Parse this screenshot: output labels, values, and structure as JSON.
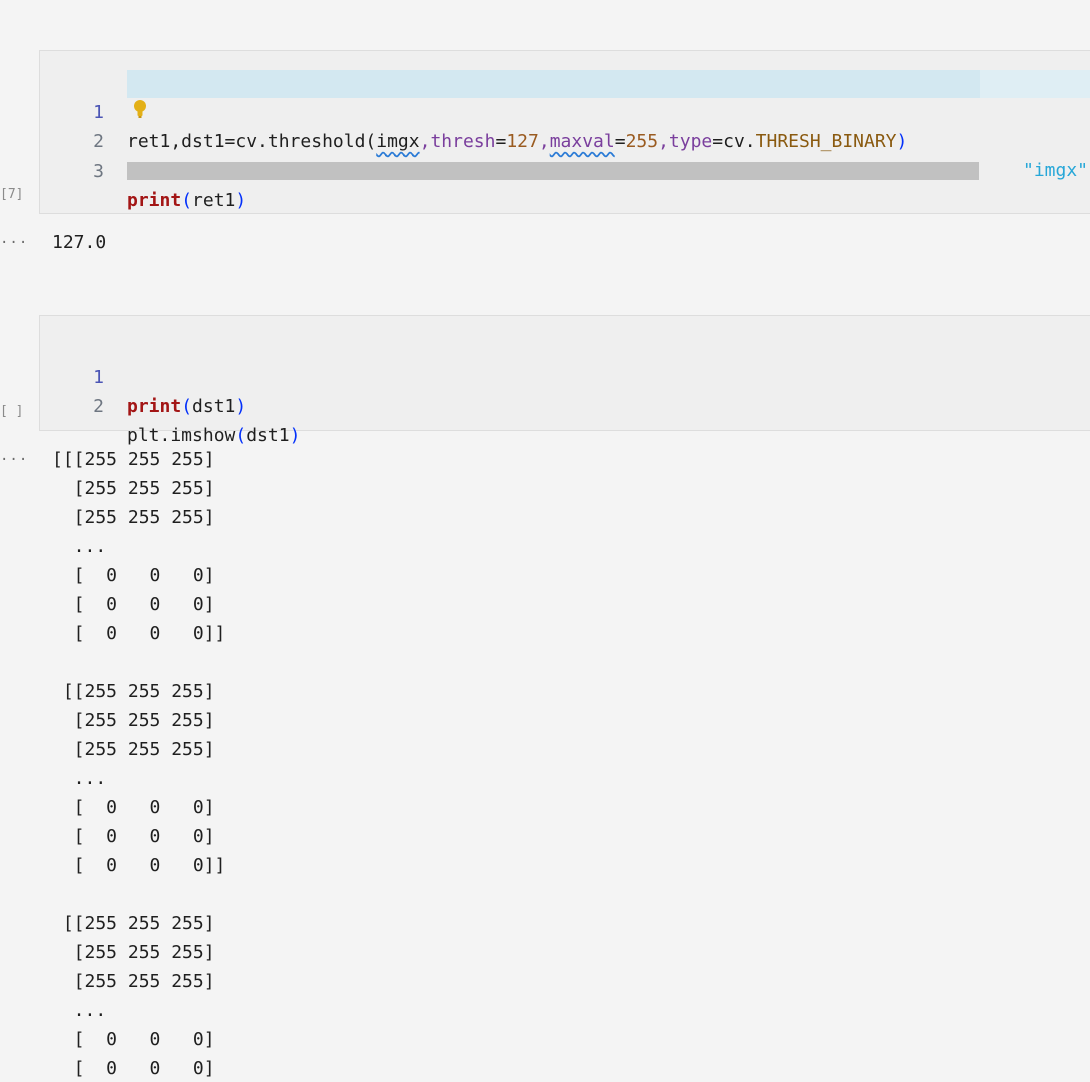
{
  "cells": [
    {
      "exec_count": "[7]",
      "lines": [
        {
          "num": "1",
          "tokens": {
            "a": "ret1,dst1=cv.threshold(",
            "b": "imgx",
            "c": ",",
            "d": "thresh",
            "e": "=",
            "f": "127",
            "g": ",",
            "h": "maxval",
            "i": "=",
            "j": "255",
            "k": ",",
            "l": "type",
            "m": "=cv.",
            "n": "THRESH_BINARY",
            "o": ")",
            "hint": "\"imgx\""
          }
        },
        {
          "num": "2"
        },
        {
          "num": "3",
          "kw": "print",
          "open": "(",
          "arg": "ret1",
          "close": ")"
        }
      ],
      "output": "127.0"
    },
    {
      "exec_count": "[ ]",
      "lines": [
        {
          "num": "1",
          "kw": "print",
          "open": "(",
          "arg": "dst1",
          "close": ")"
        },
        {
          "num": "2",
          "pre": "plt.imshow",
          "open": "(",
          "arg": "dst1",
          "close": ")"
        }
      ],
      "output": "[[[255 255 255]\n  [255 255 255]\n  [255 255 255]\n  ...\n  [  0   0   0]\n  [  0   0   0]\n  [  0   0   0]]\n\n [[255 255 255]\n  [255 255 255]\n  [255 255 255]\n  ...\n  [  0   0   0]\n  [  0   0   0]\n  [  0   0   0]]\n\n [[255 255 255]\n  [255 255 255]\n  [255 255 255]\n  ...\n  [  0   0   0]\n  [  0   0   0]"
    }
  ],
  "output_ellipsis": "...",
  "icons": {
    "lightbulb": "lightbulb-icon"
  },
  "colors": {
    "keyword": "#a31515",
    "number": "#9a5b20",
    "parameter": "#7a3e9d",
    "paren": "#0431fa",
    "hint": "#27a7d8",
    "line_highlight": "#d3e8f1"
  }
}
